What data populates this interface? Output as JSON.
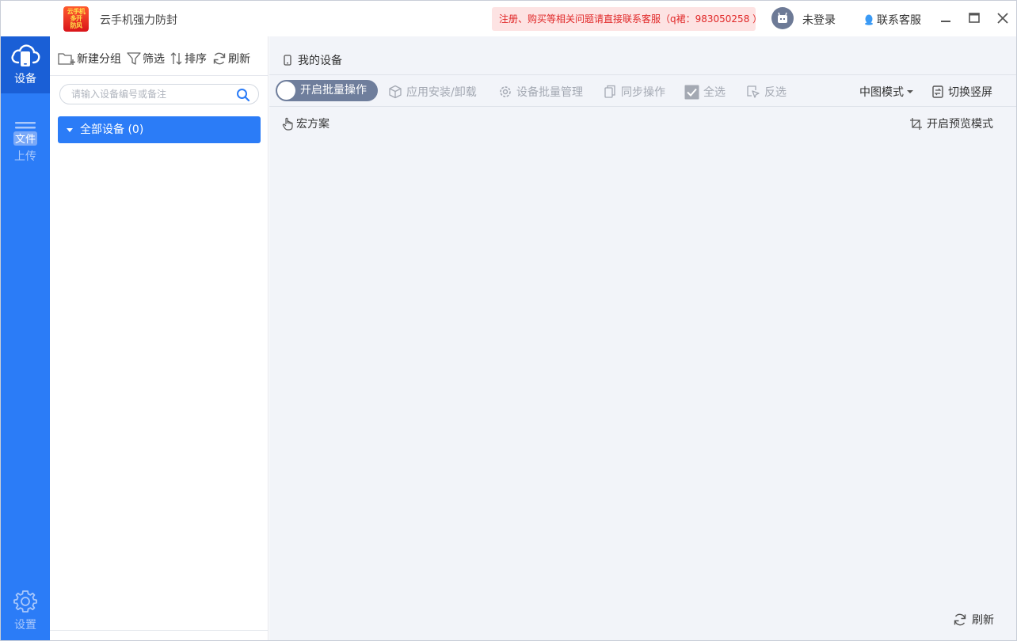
{
  "app": {
    "logo_text": "云手机多开防风",
    "title": "云手机强力防封"
  },
  "header": {
    "notice": "注册、购买等相关问题请直接联系客服（q裙：983050258 ）",
    "login_status": "未登录",
    "support_label": "联系客服"
  },
  "leftnav": {
    "items": [
      {
        "label": "设备",
        "icon": "cloud-phone-icon",
        "active": true
      },
      {
        "label_top": "文件",
        "label": "上传",
        "icon": "file-upload-icon",
        "active": false
      },
      {
        "label": "设置",
        "icon": "gear-icon",
        "active": false
      }
    ]
  },
  "sidebar": {
    "toolbar": {
      "new_group": "新建分组",
      "filter": "筛选",
      "sort": "排序",
      "refresh": "刷新"
    },
    "search": {
      "placeholder": "请输入设备编号或备注",
      "value": ""
    },
    "groups": [
      {
        "label": "全部设备 (0)",
        "selected": true
      }
    ]
  },
  "main": {
    "title": "我的设备",
    "toolbar": {
      "batch_toggle": "开启批量操作",
      "app_install": "应用安装/卸载",
      "batch_manage": "设备批量管理",
      "sync": "同步操作",
      "select_all": "全选",
      "invert": "反选",
      "view_mode": "中图模式",
      "switch_screen": "切换竖屏"
    },
    "toolbar2": {
      "macro": "宏方案",
      "preview_mode": "开启预览模式"
    },
    "refresh": "刷新"
  },
  "colors": {
    "nav_bg": "#2b7cf7",
    "nav_active": "#1a5fd6",
    "notice_bg": "#fde3e3",
    "notice_text": "#e02727",
    "toggle_bg": "#6f7e9c",
    "main_bg": "#f2f4f9"
  }
}
